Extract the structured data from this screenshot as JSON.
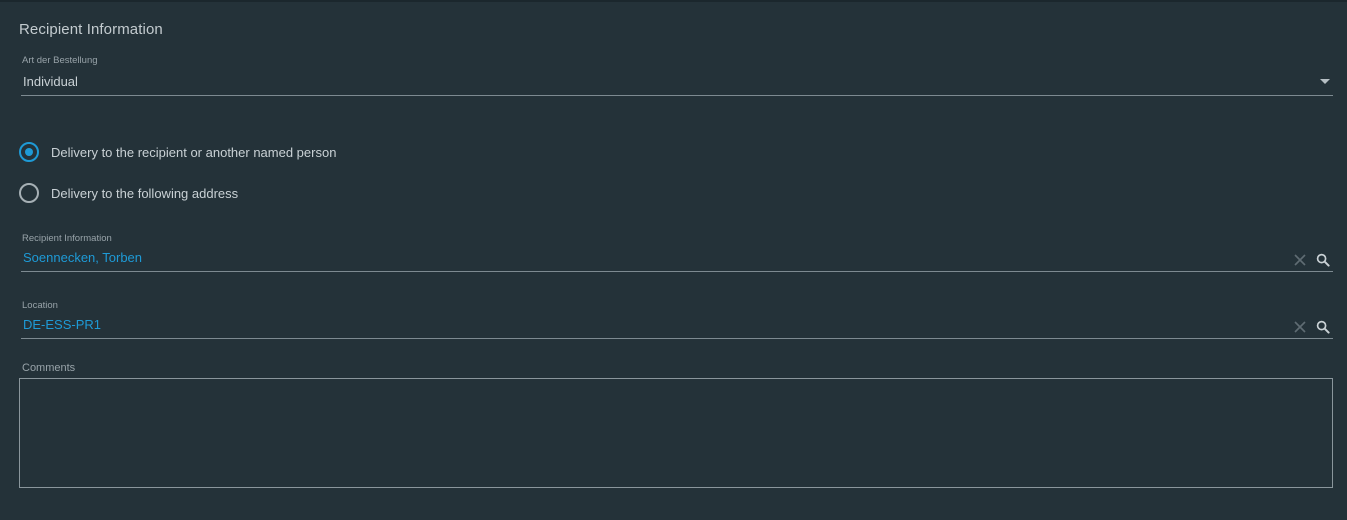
{
  "section": {
    "title": "Recipient Information"
  },
  "order_type": {
    "label": "Art der Bestellung",
    "value": "Individual",
    "icon": "chevron-down-icon"
  },
  "delivery_options": [
    {
      "label": "Delivery to the recipient or another named person",
      "checked": true
    },
    {
      "label": "Delivery to the following address",
      "checked": false
    }
  ],
  "recipient": {
    "label": "Recipient Information",
    "value": "Soennecken, Torben",
    "clear_icon": "close-icon",
    "search_icon": "search-icon"
  },
  "location": {
    "label": "Location",
    "value": "DE-ESS-PR1",
    "clear_icon": "close-icon",
    "search_icon": "search-icon"
  },
  "comments": {
    "label": "Comments",
    "value": ""
  },
  "colors": {
    "background": "#243239",
    "accent": "#1e9ad6",
    "text": "#c9d1d5",
    "muted": "#98a3a9"
  }
}
